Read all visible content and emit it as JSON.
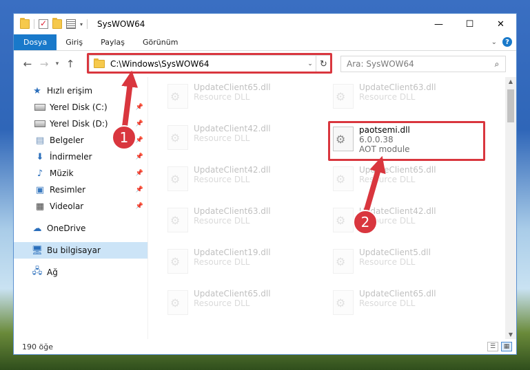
{
  "window": {
    "title": "SysWOW64",
    "controls": {
      "minimize": "—",
      "maximize": "☐",
      "close": "✕"
    }
  },
  "ribbon": {
    "tabs": [
      "Dosya",
      "Giriş",
      "Paylaş",
      "Görünüm"
    ],
    "active_tab": "Dosya",
    "help": "?"
  },
  "navigation": {
    "address": "C:\\Windows\\SysWOW64",
    "search_placeholder": "Ara: SysWOW64"
  },
  "sidebar": {
    "items": [
      {
        "label": "Hızlı erişim",
        "icon": "star-icon"
      },
      {
        "label": "Yerel Disk (C:)",
        "icon": "drive-icon",
        "pinned": true
      },
      {
        "label": "Yerel Disk (D:)",
        "icon": "drive-icon",
        "pinned": true
      },
      {
        "label": "Belgeler",
        "icon": "documents-icon",
        "pinned": true
      },
      {
        "label": "İndirmeler",
        "icon": "download-icon",
        "pinned": true
      },
      {
        "label": "Müzik",
        "icon": "music-icon",
        "pinned": true
      },
      {
        "label": "Resimler",
        "icon": "pictures-icon",
        "pinned": true
      },
      {
        "label": "Videolar",
        "icon": "videos-icon",
        "pinned": true
      },
      {
        "label": "OneDrive",
        "icon": "cloud-icon"
      },
      {
        "label": "Bu bilgisayar",
        "icon": "computer-icon",
        "selected": true
      },
      {
        "label": "Ağ",
        "icon": "network-icon"
      }
    ]
  },
  "files": {
    "highlighted": {
      "name": "paotsemi.dll",
      "version": "6.0.0.38",
      "description": "AOT module"
    },
    "faded_left": [
      {
        "name": "UpdateClient65.dll",
        "type": "Resource DLL"
      },
      {
        "name": "UpdateClient42.dll",
        "type": "Resource DLL"
      },
      {
        "name": "UpdateClient42.dll",
        "type": "Resource DLL"
      },
      {
        "name": "UpdateClient63.dll",
        "type": "Resource DLL"
      },
      {
        "name": "UpdateClient19.dll",
        "type": "Resource DLL"
      },
      {
        "name": "UpdateClient65.dll",
        "type": "Resource DLL"
      }
    ],
    "faded_right": [
      {
        "name": "UpdateClient63.dll",
        "type": "Resource DLL"
      },
      {
        "name": "UpdateClient65.dll",
        "type": "Resource DLL"
      },
      {
        "name": "UpdateClient42.dll",
        "type": "Resource DLL"
      },
      {
        "name": "UpdateClient5.dll",
        "type": "Resource DLL"
      },
      {
        "name": "UpdateClient65.dll",
        "type": "Resource DLL"
      }
    ]
  },
  "status": {
    "count": "190 öğe"
  },
  "annotations": {
    "step1": "1",
    "step2": "2",
    "color": "#d9363e"
  }
}
